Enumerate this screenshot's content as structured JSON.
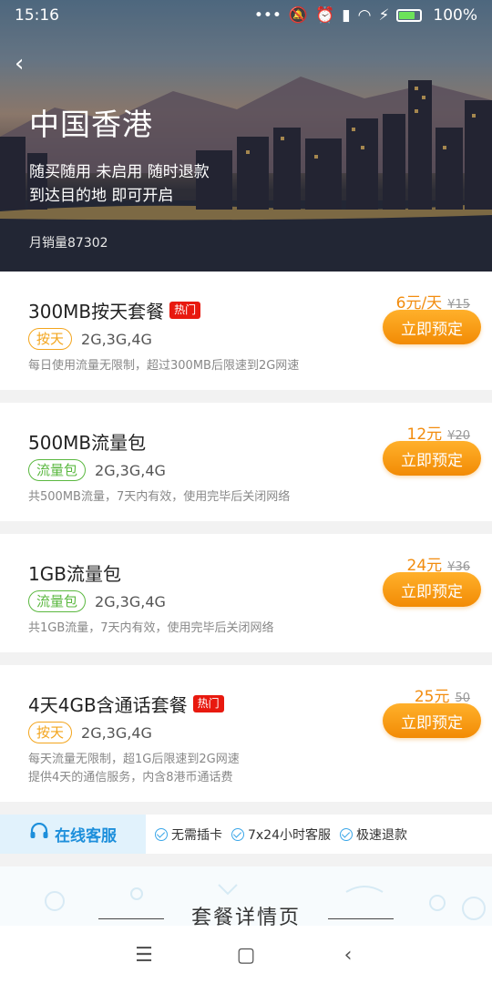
{
  "status_bar": {
    "time": "15:16",
    "battery": "100%"
  },
  "hero": {
    "title": "中国香港",
    "subtitle_line1": "随买随用 未启用 随时退款",
    "subtitle_line2": "到达目的地 即可开启",
    "monthly_sales": "月销量87302"
  },
  "plans": [
    {
      "name": "300MB按天套餐",
      "hot": "热门",
      "tag": "按天",
      "tag_type": "daily",
      "network": "2G,3G,4G",
      "desc": [
        "每日使用流量无限制，超过300MB后限速到2G网速"
      ],
      "price": "6元/天",
      "orig_price": "¥15",
      "book": "立即预定"
    },
    {
      "name": "500MB流量包",
      "hot": "",
      "tag": "流量包",
      "tag_type": "pack",
      "network": "2G,3G,4G",
      "desc": [
        "共500MB流量，7天内有效，使用完毕后关闭网络"
      ],
      "price": "12元",
      "orig_price": "¥20",
      "book": "立即预定"
    },
    {
      "name": "1GB流量包",
      "hot": "",
      "tag": "流量包",
      "tag_type": "pack",
      "network": "2G,3G,4G",
      "desc": [
        "共1GB流量，7天内有效，使用完毕后关闭网络"
      ],
      "price": "24元",
      "orig_price": "¥36",
      "book": "立即预定"
    },
    {
      "name": "4天4GB含通话套餐",
      "hot": "热门",
      "tag": "按天",
      "tag_type": "daily",
      "network": "2G,3G,4G",
      "desc": [
        "每天流量无限制，超1G后限速到2G网速",
        "提供4天的通信服务，内含8港币通话费"
      ],
      "price": "25元",
      "orig_price": "50",
      "book": "立即预定"
    }
  ],
  "service": {
    "online_cs": "在线客服",
    "features": [
      "无需插卡",
      "7x24小时客服",
      "极速退款"
    ]
  },
  "details": {
    "title": "套餐详情页"
  },
  "colors": {
    "accent_orange": "#f28c0e",
    "hot_red": "#e8190f",
    "cs_blue": "#1d8fdb"
  }
}
